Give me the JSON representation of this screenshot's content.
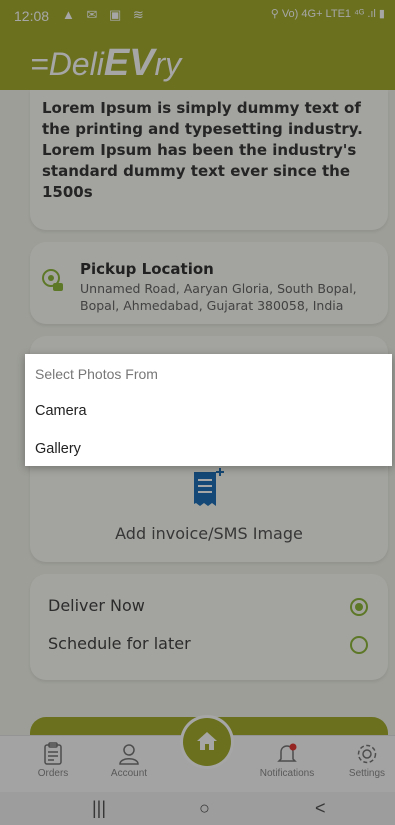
{
  "status_bar": {
    "time": "12:08",
    "left_icons": "▲ ✉ ▣ ≋",
    "right_icons": "⚲ Vo) 4G+ LTE1 ⁴ᴳ .ıl ▮"
  },
  "header": {
    "logo_prefix": "=Deli",
    "logo_ev": "EV",
    "logo_suffix": "ry"
  },
  "description": {
    "text": "Lorem Ipsum is simply dummy text of the printing and typesetting industry. Lorem Ipsum has been the industry's standard dummy text ever since the 1500s"
  },
  "pickup": {
    "title": "Pickup Location",
    "address": "Unnamed Road, Aaryan Gloria, South Bopal, Bopal, Ahmedabad, Gujarat 380058, India"
  },
  "invoice": {
    "label": "Add invoice/SMS Image"
  },
  "delivery_options": [
    {
      "label": "Deliver Now",
      "selected": true
    },
    {
      "label": "Schedule for later",
      "selected": false
    }
  ],
  "bottom_nav": {
    "orders": "Orders",
    "account": "Account",
    "notifications": "Notifications",
    "settings": "Settings"
  },
  "dialog": {
    "title": "Select Photos From",
    "camera": "Camera",
    "gallery": "Gallery"
  },
  "system_nav": {
    "recents": "|||",
    "home": "○",
    "back": "<"
  },
  "colors": {
    "brand": "#a3ad2e",
    "radio": "#8fb83d",
    "invoice_icon": "#1f6fb5"
  }
}
